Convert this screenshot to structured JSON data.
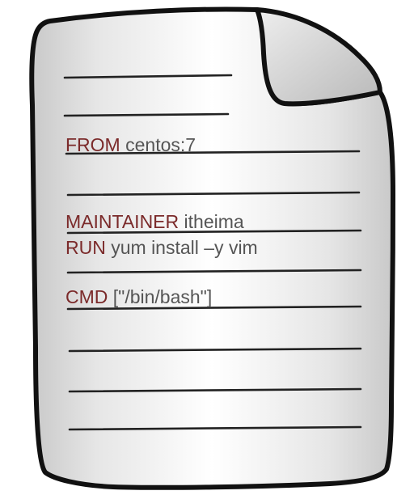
{
  "colors": {
    "keyword": "#7b2a2a",
    "argument": "#555555",
    "outline": "#111111",
    "page_fill": "#ececec",
    "fold_fill": "#c8c8c8"
  },
  "document": {
    "icon": "dog-eared-paper-document-icon",
    "lines": [
      {
        "keyword": "FROM",
        "argument": "centos:7"
      },
      {
        "keyword": "MAINTAINER",
        "argument": "itheima"
      },
      {
        "keyword": "RUN",
        "argument": "yum install –y vim"
      },
      {
        "keyword": "CMD",
        "argument": "[\"/bin/bash\"]"
      }
    ]
  }
}
